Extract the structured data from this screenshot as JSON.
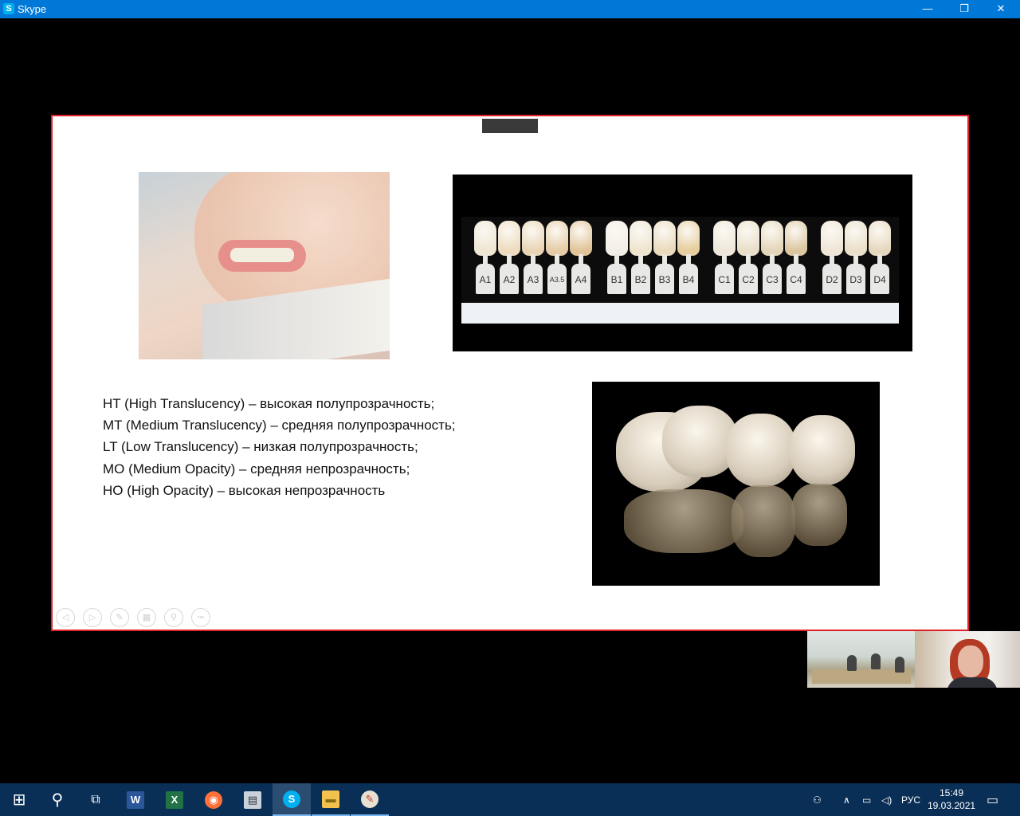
{
  "window": {
    "title": "Skype",
    "icon": "S",
    "minimize": "—",
    "maximize": "❐",
    "close": "✕"
  },
  "slide": {
    "shade_labels": [
      "A1",
      "A2",
      "A3",
      "A3.5",
      "A4",
      "B1",
      "B2",
      "B3",
      "B4",
      "C1",
      "C2",
      "C3",
      "C4",
      "D2",
      "D3",
      "D4"
    ],
    "lines": [
      "HT (High Translucency) – высокая полупрозрачность;",
      "MT (Medium Translucency) – средняя полупрозрачность;",
      "LT (Low Translucency) – низкая полупрозрачность;",
      "MO (Medium Opacity) – средняя непрозрачность;",
      "HO (High Opacity) – высокая непрозрачность"
    ],
    "controls": [
      {
        "name": "prev-slide-icon",
        "glyph": "◁"
      },
      {
        "name": "next-slide-icon",
        "glyph": "▷"
      },
      {
        "name": "pen-icon",
        "glyph": "✎"
      },
      {
        "name": "slides-grid-icon",
        "glyph": "▦"
      },
      {
        "name": "zoom-icon",
        "glyph": "⚲"
      },
      {
        "name": "more-icon",
        "glyph": "•••"
      }
    ]
  },
  "taskbar": {
    "language": "РУС",
    "time": "15:49",
    "date": "19.03.2021",
    "apps": [
      {
        "name": "start-button",
        "glyph": "⊞"
      },
      {
        "name": "search-icon",
        "glyph": "⚲"
      },
      {
        "name": "task-view-icon",
        "glyph": "⧉"
      },
      {
        "name": "word-icon",
        "glyph": "W"
      },
      {
        "name": "excel-icon",
        "glyph": "X"
      },
      {
        "name": "firefox-icon",
        "glyph": "◉"
      },
      {
        "name": "calculator-icon",
        "glyph": "▤"
      },
      {
        "name": "skype-icon",
        "glyph": "S"
      },
      {
        "name": "file-explorer-icon",
        "glyph": "▬"
      },
      {
        "name": "paint-icon",
        "glyph": "✎"
      }
    ]
  },
  "colors": {
    "titlebar": "#0078d7",
    "taskbar": "#0a2f57",
    "slide_border": "#e0202a",
    "word": "#2b579a",
    "excel": "#217346",
    "skype": "#00aff0",
    "firefox": "#ff7139"
  }
}
